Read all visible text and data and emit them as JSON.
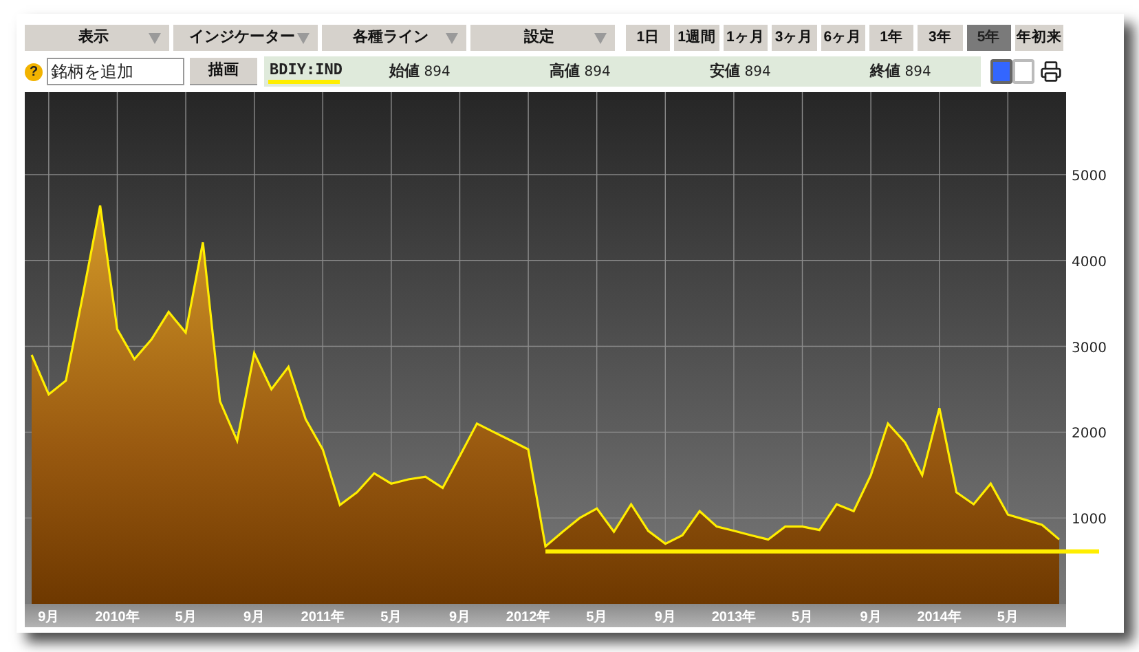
{
  "menus": [
    {
      "label": "表示"
    },
    {
      "label": "インジケーター"
    },
    {
      "label": "各種ライン"
    },
    {
      "label": "設定"
    }
  ],
  "ranges": [
    {
      "label": "1日",
      "selected": false
    },
    {
      "label": "1週間",
      "selected": false
    },
    {
      "label": "1ヶ月",
      "selected": false
    },
    {
      "label": "3ヶ月",
      "selected": false
    },
    {
      "label": "6ヶ月",
      "selected": false
    },
    {
      "label": "1年",
      "selected": false
    },
    {
      "label": "3年",
      "selected": false
    },
    {
      "label": "5年",
      "selected": true
    },
    {
      "label": "年初来",
      "selected": false
    }
  ],
  "help": "?",
  "symbol_input": {
    "placeholder": "銘柄を追加"
  },
  "draw_button": "描画",
  "quote": {
    "symbol": "BDIY:IND",
    "fields": [
      {
        "label": "始値",
        "value": "894"
      },
      {
        "label": "高値",
        "value": "894"
      },
      {
        "label": "安値",
        "value": "894"
      },
      {
        "label": "終値",
        "value": "894"
      }
    ]
  },
  "color_toggles": [
    {
      "color": "#3366ff",
      "selected": true
    },
    {
      "color": "#ffffff",
      "selected": false
    }
  ],
  "chart": {
    "chart_data": {
      "type": "area",
      "categories": [
        null,
        "9月",
        null,
        null,
        null,
        "2010年",
        null,
        null,
        null,
        "5月",
        null,
        null,
        null,
        "9月",
        null,
        null,
        null,
        "2011年",
        null,
        null,
        null,
        "5月",
        null,
        null,
        null,
        "9月",
        null,
        null,
        null,
        "2012年",
        null,
        null,
        null,
        "5月",
        null,
        null,
        null,
        "9月",
        null,
        null,
        null,
        "2013年",
        null,
        null,
        null,
        "5月",
        null,
        null,
        null,
        "9月",
        null,
        null,
        null,
        "2014年",
        null,
        null,
        null,
        "5月",
        null,
        null,
        null
      ],
      "series": [
        {
          "color": "#ffee00",
          "values": [
            2900,
            2440,
            2600,
            3600,
            4640,
            3200,
            2850,
            3080,
            3400,
            3160,
            4210,
            2360,
            1900,
            2920,
            2500,
            2760,
            2150,
            1800,
            1150,
            1300,
            1520,
            1400,
            1450,
            1480,
            1350,
            1720,
            2100,
            2000,
            1900,
            1800,
            670,
            840,
            1000,
            1110,
            840,
            1160,
            850,
            700,
            800,
            1080,
            900,
            850,
            800,
            750,
            900,
            900,
            860,
            1160,
            1080,
            1500,
            2100,
            1880,
            1500,
            2280,
            1300,
            1160,
            1400,
            1040,
            980,
            920,
            750
          ]
        },
        {
          "type": "line",
          "color": "#ffee00",
          "values": [
            null,
            null,
            null,
            null,
            null,
            null,
            null,
            null,
            null,
            null,
            null,
            null,
            null,
            null,
            null,
            null,
            null,
            null,
            null,
            null,
            null,
            null,
            null,
            null,
            null,
            null,
            null,
            null,
            null,
            null,
            610,
            610,
            610,
            610,
            610,
            610,
            610,
            610,
            610,
            610,
            610,
            610,
            610,
            610,
            610,
            610,
            610,
            610,
            610,
            610,
            610,
            610,
            610,
            610,
            610,
            610,
            610,
            610,
            610,
            610,
            610
          ]
        }
      ],
      "ylim": [
        0,
        5960
      ],
      "yticks": [
        1000,
        2000,
        3000,
        4000,
        5000
      ],
      "grid": true
    }
  }
}
